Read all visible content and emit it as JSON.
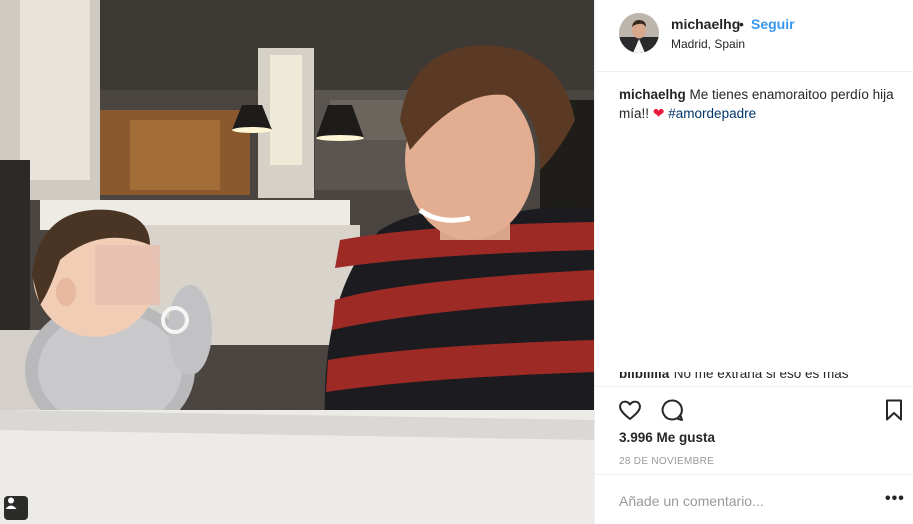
{
  "post": {
    "username": "michaelhg",
    "separator": "•",
    "follow_label": "Seguir",
    "location": "Madrid, Spain"
  },
  "caption": {
    "username": "michaelhg",
    "text": "Me tienes enamoraitoo perdío hija mía!!",
    "heart": "❤",
    "hashtag": "#amordepadre"
  },
  "partial_comment": {
    "username": "bilbililla",
    "text": "No me extraña si eso es más"
  },
  "actions": {
    "like_icon": "heart-outline-icon",
    "comment_icon": "comment-bubble-icon",
    "save_icon": "bookmark-icon"
  },
  "likes": "3.996 Me gusta",
  "date": "28 DE NOVIEMBRE",
  "comment_box": {
    "placeholder": "Añade un comentario...",
    "more_label": "•••"
  },
  "colors": {
    "link": "#3897f0",
    "hashtag": "#003569",
    "heart": "#ed1b3b",
    "border": "#efefef"
  }
}
